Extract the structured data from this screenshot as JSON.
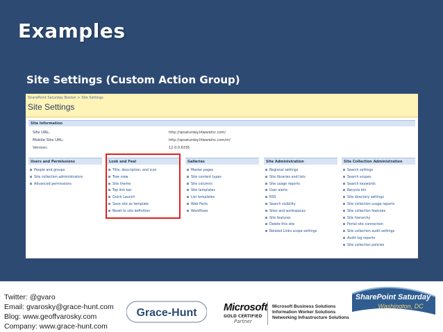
{
  "slide": {
    "title": "Examples",
    "subtitle": "Site Settings (Custom Action Group)"
  },
  "screenshot": {
    "breadcrumb": "SharePoint Saturday Boston > Site Settings",
    "page_title": "Site Settings",
    "site_information": {
      "heading": "Site Information",
      "rows": [
        {
          "label": "Site URL:",
          "value": "http://spsaturday.litwareinc.com/"
        },
        {
          "label": "Mobile Site URL:",
          "value": "http://spsaturday.litwareinc.com/m/"
        },
        {
          "label": "Version:",
          "value": "12.0.0.6335"
        }
      ]
    },
    "columns": [
      {
        "heading": "Users and Permissions",
        "items": [
          "People and groups",
          "Site collection administrators",
          "Advanced permissions"
        ]
      },
      {
        "heading": "Look and Feel",
        "items": [
          "Title, description, and icon",
          "Tree view",
          "Site theme",
          "Top link bar",
          "Quick Launch",
          "Save site as template",
          "Reset to site definition"
        ]
      },
      {
        "heading": "Galleries",
        "items": [
          "Master pages",
          "Site content types",
          "Site columns",
          "Site templates",
          "List templates",
          "Web Parts",
          "Workflows"
        ]
      },
      {
        "heading": "Site Administration",
        "items": [
          "Regional settings",
          "Site libraries and lists",
          "Site usage reports",
          "User alerts",
          "RSS",
          "Search visibility",
          "Sites and workspaces",
          "Site features",
          "Delete this site",
          "Related Links scope settings"
        ]
      },
      {
        "heading": "Site Collection Administration",
        "items": [
          "Search settings",
          "Search scopes",
          "Search keywords",
          "Recycle bin",
          "Site directory settings",
          "Site collection usage reports",
          "Site collection features",
          "Site hierarchy",
          "Portal site connection",
          "Site collection audit settings",
          "Audit log reports",
          "Site collection policies"
        ]
      }
    ]
  },
  "footer": {
    "contact": [
      "Twitter: @gvaro",
      "Email: gvarosky@grace-hunt.com",
      "Blog: www.geoffvarosky.com",
      "Company: www.grace-hunt.com"
    ],
    "grace_hunt_logo": "Grace-Hunt",
    "microsoft": {
      "wordmark": "Microsoft",
      "certification": "GOLD CERTIFIED",
      "partner": "Partner",
      "competencies": [
        "Microsoft Business Solutions",
        "Information Worker Solutions",
        "Networking Infrastructure Solutions"
      ]
    },
    "sps_logo": {
      "line1": "SharePoint Saturday",
      "line2": "Washington, DC"
    }
  },
  "colors": {
    "slide_bg": "#2d4a73",
    "highlight": "#e02020",
    "sp_header": "#fff4b8"
  }
}
